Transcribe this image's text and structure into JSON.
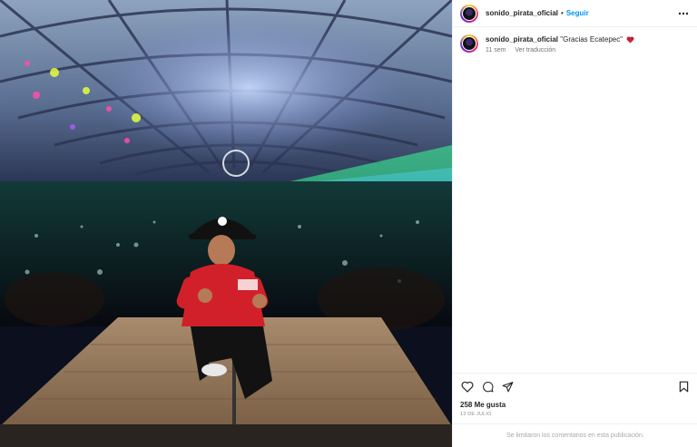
{
  "post": {
    "username": "sonido_pirata_oficial",
    "follow_label": "Seguir",
    "separator": "•",
    "more_glyph": "•••",
    "caption_text": "\"Gracias Ecatepec\"",
    "caption_emoji": "red-heart-emoji",
    "time_ago": "11 sem",
    "translate_label": "Ver traducción",
    "likes_label": "258 Me gusta",
    "date_label": "13 DE JULIO",
    "comments_disabled": "Se limitaron los comentarios en esta publicación."
  },
  "icons": {
    "like": "heart-icon",
    "comment": "comment-icon",
    "share": "share-icon",
    "save": "bookmark-icon",
    "more": "more-options-icon"
  },
  "colors": {
    "link_blue": "#0095f6",
    "text": "#262626",
    "muted": "#737373",
    "border": "#efefef"
  }
}
